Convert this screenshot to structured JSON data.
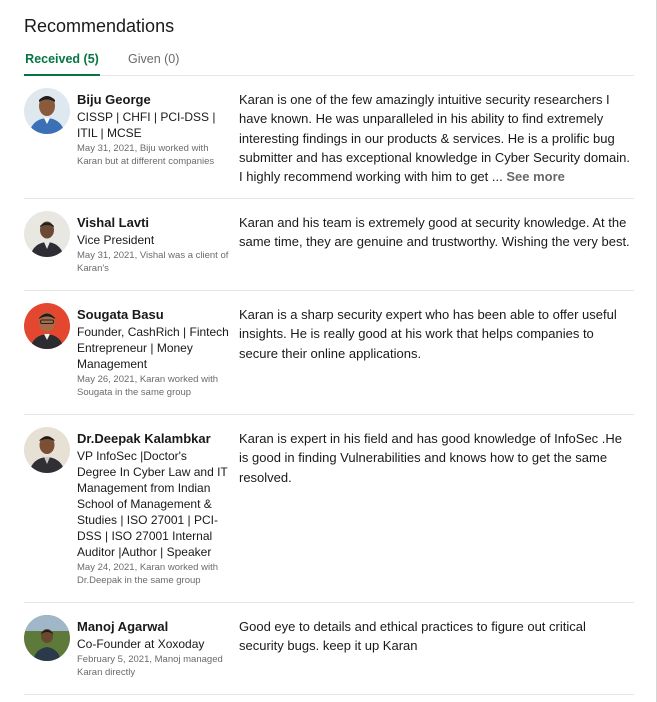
{
  "section": {
    "title": "Recommendations"
  },
  "tabs": [
    {
      "label": "Received (5)",
      "selected": true
    },
    {
      "label": "Given (0)",
      "selected": false
    }
  ],
  "colors": {
    "accent_green": "#057642",
    "divider": "#e6e6e6"
  },
  "recommendations": [
    {
      "name": "Biju George",
      "headline": "CISSP | CHFI | PCI-DSS | ITIL | MCSE",
      "meta": "May 31, 2021, Biju worked with Karan but at different companies",
      "text": "Karan is one of the few amazingly intuitive security researchers I have known. He was unparalleled in his ability to find extremely interesting findings in our products & services. He is a prolific bug submitter and has exceptional knowledge in Cyber Security domain. I highly recommend working with him to get ...",
      "see_more": "See more"
    },
    {
      "name": "Vishal Lavti",
      "headline": "Vice President",
      "meta": "May 31, 2021, Vishal was a client of Karan's",
      "text": "Karan and his team is extremely good at security knowledge. At the same time, they are genuine and trustworthy. Wishing the very best."
    },
    {
      "name": "Sougata Basu",
      "headline": "Founder, CashRich | Fintech Entrepreneur | Money Management",
      "meta": "May 26, 2021, Karan worked with Sougata in the same group",
      "text": "Karan is a sharp security expert who has been able to offer useful insights. He is really good at his work that helps companies to secure their online applications."
    },
    {
      "name": "Dr.Deepak Kalambkar",
      "headline": "VP InfoSec |Doctor's Degree In Cyber Law and IT Management from Indian School of Management & Studies | ISO 27001 | PCI-DSS | ISO 27001 Internal Auditor |Author | Speaker",
      "meta": "May 24, 2021, Karan worked with Dr.Deepak in the same group",
      "text": "Karan is expert in his field and has good knowledge of InfoSec .He is good in finding Vulnerabilities and knows how to get the same resolved."
    },
    {
      "name": "Manoj Agarwal",
      "headline": "Co-Founder at Xoxoday",
      "meta": "February 5, 2021, Manoj managed Karan directly",
      "text": "Good eye to details and ethical practices to figure out critical security bugs. keep it up Karan"
    }
  ]
}
